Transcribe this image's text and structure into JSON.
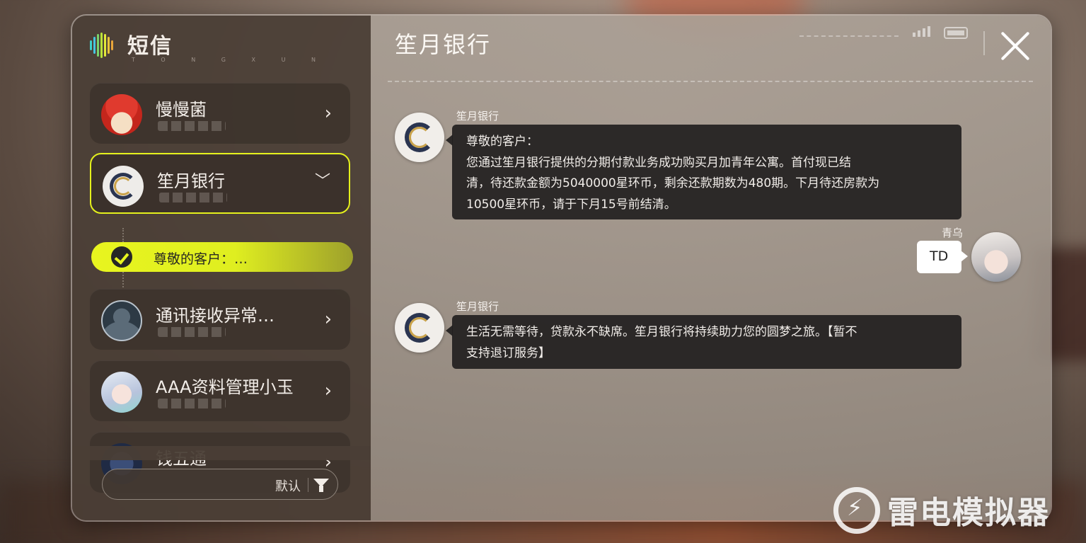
{
  "app": {
    "title": "短信",
    "subtitle": "T O N G X U N"
  },
  "contacts": [
    {
      "name": "慢慢菌",
      "state": "collapsed"
    },
    {
      "name": "笙月银行",
      "state": "expanded"
    },
    {
      "name": "通讯接收异常…",
      "state": "collapsed"
    },
    {
      "name": "AAA资料管理小玉",
      "state": "collapsed"
    },
    {
      "name": "钱五通",
      "state": "collapsed"
    }
  ],
  "active_thread_preview": "尊敬的客户：…",
  "filter": {
    "label": "默认"
  },
  "chat": {
    "title": "笙月银行",
    "messages": [
      {
        "sender": "笙月银行",
        "side": "left",
        "lines": [
          "尊敬的客户：",
          "您通过笙月银行提供的分期付款业务成功购买月加青年公寓。首付现已结",
          "清，待还款金额为5040000星环币，剩余还款期数为480期。下月待还房款为",
          "10500星环币，请于下月15号前结清。"
        ]
      },
      {
        "sender": "青乌",
        "side": "right",
        "lines": [
          "TD"
        ]
      },
      {
        "sender": "笙月银行",
        "side": "left",
        "lines": [
          "生活无需等待，贷款永不缺席。笙月银行将持续助力您的圆梦之旅。【暂不",
          "支持退订服务】"
        ]
      }
    ]
  },
  "watermark": "雷电模拟器",
  "colors": {
    "accent": "#e4f01c",
    "bubble_dark": "#222020",
    "bubble_light": "#ffffff"
  },
  "icons": [
    "app-logo-icon",
    "chevron-right-icon",
    "chevron-down-icon",
    "check-icon",
    "filter-icon",
    "signal-icon",
    "battery-icon",
    "close-icon"
  ]
}
